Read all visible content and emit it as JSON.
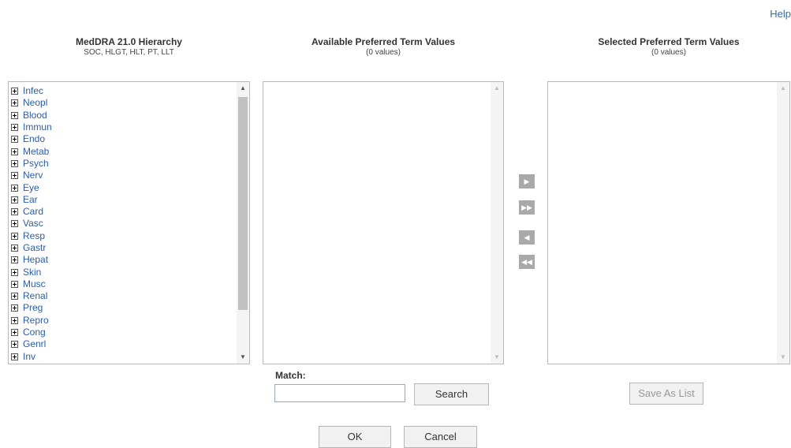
{
  "help_link": "Help",
  "hierarchy": {
    "title": "MedDRA 21.0 Hierarchy",
    "subtitle": "SOC, HLGT, HLT, PT, LLT",
    "items": [
      "Infec",
      "Neopl",
      "Blood",
      "Immun",
      "Endo",
      "Metab",
      "Psych",
      "Nerv",
      "Eye",
      "Ear",
      "Card",
      "Vasc",
      "Resp",
      "Gastr",
      "Hepat",
      "Skin",
      "Musc",
      "Renal",
      "Preg",
      "Repro",
      "Cong",
      "Genrl",
      "Inv"
    ]
  },
  "available": {
    "title": "Available Preferred Term Values",
    "count": "(0 values)"
  },
  "selected": {
    "title": "Selected Preferred Term Values",
    "count": "(0 values)"
  },
  "match": {
    "label": "Match:",
    "value": ""
  },
  "buttons": {
    "search": "Search",
    "save_as_list": "Save As List",
    "ok": "OK",
    "cancel": "Cancel"
  },
  "arrows": {
    "add": "▶",
    "add_all": "▶▶",
    "remove": "◀",
    "remove_all": "◀◀"
  }
}
